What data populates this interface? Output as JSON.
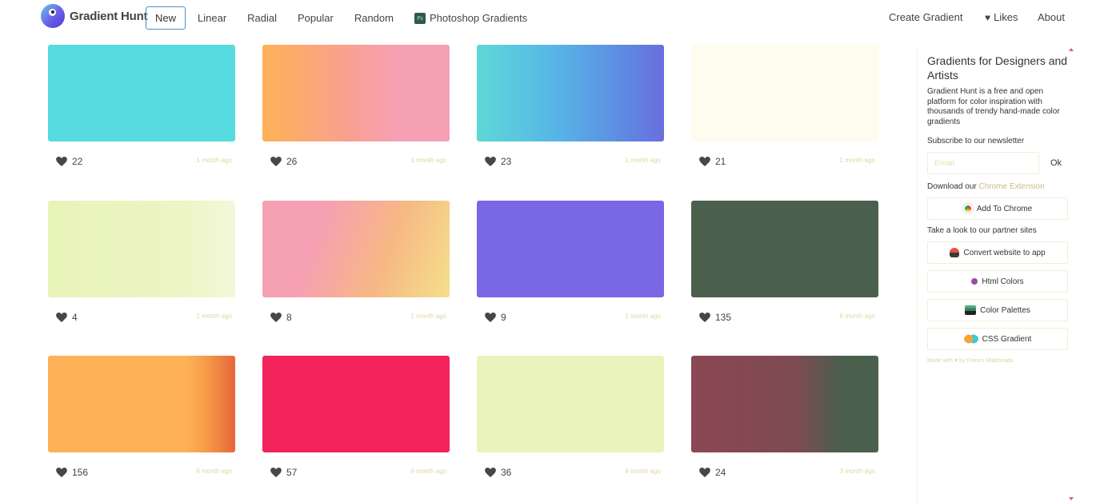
{
  "header": {
    "logo_text": "Gradient Hunt",
    "nav": [
      {
        "label": "New",
        "active": true
      },
      {
        "label": "Linear"
      },
      {
        "label": "Radial"
      },
      {
        "label": "Popular"
      },
      {
        "label": "Random"
      },
      {
        "label": "Photoshop Gradients",
        "icon": "photoshop-icon"
      }
    ],
    "create_label": "Create Gradient",
    "likes_label": "Likes",
    "about_label": "About"
  },
  "cards": [
    {
      "likes": "22",
      "ago": "1 month ago",
      "gradient": "linear-gradient(90deg,#56dbe0,#56dbe0)"
    },
    {
      "likes": "26",
      "ago": "1 month ago",
      "gradient": "linear-gradient(90deg,#ffb157 0%,#f9a08f 45%,#f6a0b3 70%,#f6a0b3 100%)"
    },
    {
      "likes": "23",
      "ago": "1 month ago",
      "gradient": "linear-gradient(90deg,#5ed8d8 0%,#57b7e6 40%,#5f88e2 80%,#6a6ede 100%)"
    },
    {
      "likes": "21",
      "ago": "1 month ago",
      "gradient": "linear-gradient(90deg,#fdfcee,#fdfcee)"
    },
    {
      "likes": "4",
      "ago": "1 month ago",
      "gradient": "linear-gradient(90deg,#e9f4b8 0%,#ecf5c4 70%,#f3f8da 100%)"
    },
    {
      "likes": "8",
      "ago": "1 month ago",
      "gradient": "linear-gradient(110deg,#f6a0b3 0%,#f6a0b3 30%,#f7b884 65%,#f4e08b 100%)"
    },
    {
      "likes": "9",
      "ago": "1 month ago",
      "gradient": "linear-gradient(90deg,#7a67e3,#7a67e3)"
    },
    {
      "likes": "135",
      "ago": "6 month ago",
      "gradient": "linear-gradient(90deg,#4b5f4d,#4b5f4d)"
    },
    {
      "likes": "156",
      "ago": "6 month ago",
      "gradient": "linear-gradient(90deg,#ffb157 0%,#ffb157 74%,#f59a47 85%,#e7663a 100%)"
    },
    {
      "likes": "57",
      "ago": "6 month ago",
      "gradient": "linear-gradient(90deg,#f2225a,#f2225a)"
    },
    {
      "likes": "36",
      "ago": "6 month ago",
      "gradient": "linear-gradient(90deg,#eaf3bb,#eaf3bb)"
    },
    {
      "likes": "24",
      "ago": "3 month ago",
      "gradient": "linear-gradient(90deg,#8a4754 0%,#7f4a52 55%,#4b5f4d 80%,#4b5f4d 100%)"
    }
  ],
  "sidebar": {
    "title": "Gradients for Designers and Artists",
    "description": "Gradient Hunt is a free and open platform for color inspiration with thousands of trendy hand-made color gradients",
    "newsletter_label": "Subscribe to our newsletter",
    "email_placeholder": "Email",
    "ok_label": "Ok",
    "download_prefix": "Download our ",
    "download_link": "Chrome Extension",
    "add_chrome_label": "Add To Chrome",
    "partner_label": "Take a look to our partner sites",
    "partners": [
      {
        "label": "Convert website to app",
        "icon": "app-icon"
      },
      {
        "label": "Html Colors",
        "icon": "html-colors-icon"
      },
      {
        "label": "Color Palettes",
        "icon": "palettes-icon"
      },
      {
        "label": "CSS Gradient",
        "icon": "css-gradient-icon"
      }
    ],
    "made_by": "Made with ♥ by Franco Maldonado"
  }
}
